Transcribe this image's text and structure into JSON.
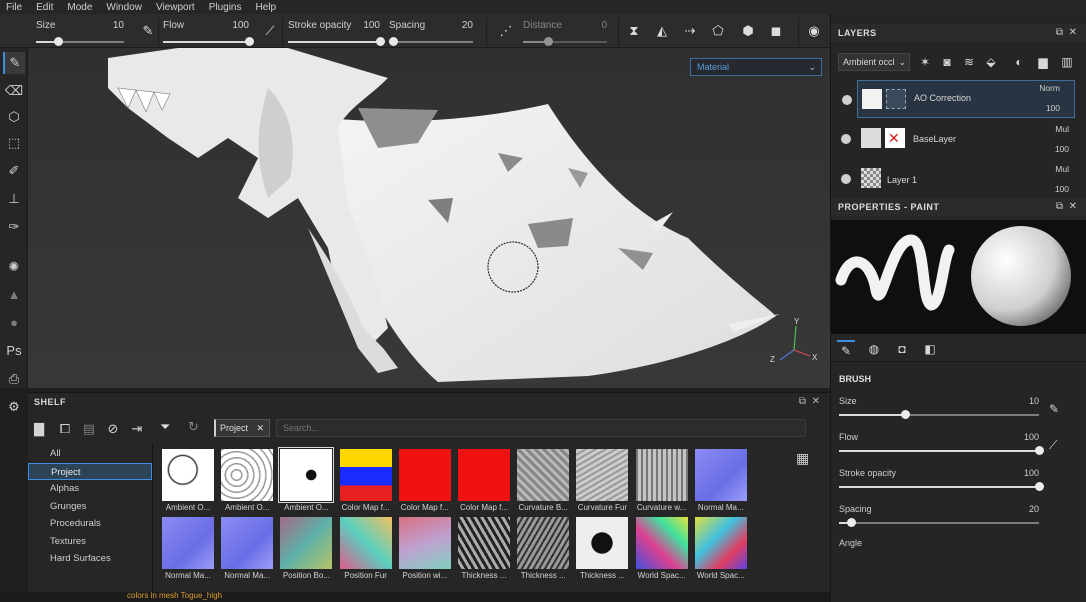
{
  "menu": [
    "File",
    "Edit",
    "Mode",
    "Window",
    "Viewport",
    "Plugins",
    "Help"
  ],
  "toolbar": {
    "size_label": "Size",
    "size_value": "10",
    "size_fraction": 0.25,
    "flow_label": "Flow",
    "flow_value": "100",
    "flow_fraction": 1.0,
    "stroke_opacity_label": "Stroke opacity",
    "stroke_opacity_value": "100",
    "stroke_opacity_fraction": 1.0,
    "spacing_label": "Spacing",
    "spacing_value": "20",
    "spacing_fraction": 0.05,
    "distance_label": "Distance",
    "distance_value": "0",
    "distance_fraction": 0.3
  },
  "viewport": {
    "channel_value": "Material"
  },
  "shelf": {
    "title": "SHELF",
    "categories": [
      "All",
      "Project",
      "Alphas",
      "Grunges",
      "Procedurals",
      "Textures",
      "Hard Surfaces"
    ],
    "selected_category": "Project",
    "filter_tag": "Project",
    "search_placeholder": "Search...",
    "items": [
      {
        "label": "Ambient O...",
        "kind": "ao"
      },
      {
        "label": "Ambient O...",
        "kind": "ao2"
      },
      {
        "label": "Ambient O...",
        "kind": "ao3"
      },
      {
        "label": "Color Map f...",
        "kind": "colormap"
      },
      {
        "label": "Color Map f...",
        "kind": "red"
      },
      {
        "label": "Color Map f...",
        "kind": "red"
      },
      {
        "label": "Curvature B...",
        "kind": "gray"
      },
      {
        "label": "Curvature Fur",
        "kind": "gray2"
      },
      {
        "label": "Curvature w...",
        "kind": "gray3"
      },
      {
        "label": "Normal Ma...",
        "kind": "normal"
      },
      {
        "label": "Normal Ma...",
        "kind": "normal"
      },
      {
        "label": "Normal Ma...",
        "kind": "normal"
      },
      {
        "label": "Position Bo...",
        "kind": "pos"
      },
      {
        "label": "Position Fur",
        "kind": "pos2"
      },
      {
        "label": "Position wi...",
        "kind": "pos3"
      },
      {
        "label": "Thickness ...",
        "kind": "thick"
      },
      {
        "label": "Thickness ...",
        "kind": "thick2"
      },
      {
        "label": "Thickness ...",
        "kind": "thick3"
      },
      {
        "label": "World Spac...",
        "kind": "world"
      },
      {
        "label": "World Spac...",
        "kind": "world2"
      }
    ]
  },
  "status": {
    "message": "colors in mesh Togue_high"
  },
  "layers": {
    "title": "LAYERS",
    "channel_select": "Ambient occl",
    "items": [
      {
        "name": "AO Correction",
        "blend": "Norm",
        "opacity": "100"
      },
      {
        "name": "BaseLayer",
        "blend": "Mul",
        "opacity": "100"
      },
      {
        "name": "Layer 1",
        "blend": "Mul",
        "opacity": "100"
      }
    ],
    "extra_opacity": "100"
  },
  "properties": {
    "title": "PROPERTIES - PAINT",
    "brush_section": "BRUSH",
    "size_label": "Size",
    "size_value": "10",
    "size_fraction": 0.33,
    "flow_label": "Flow",
    "flow_value": "100",
    "flow_fraction": 1.0,
    "stroke_opacity_label": "Stroke opacity",
    "stroke_opacity_value": "100",
    "stroke_opacity_fraction": 1.0,
    "spacing_label": "Spacing",
    "spacing_value": "20",
    "spacing_fraction": 0.06,
    "angle_label": "Angle"
  },
  "colors": {
    "accent": "#3d8de0",
    "status": "#e0a030"
  }
}
